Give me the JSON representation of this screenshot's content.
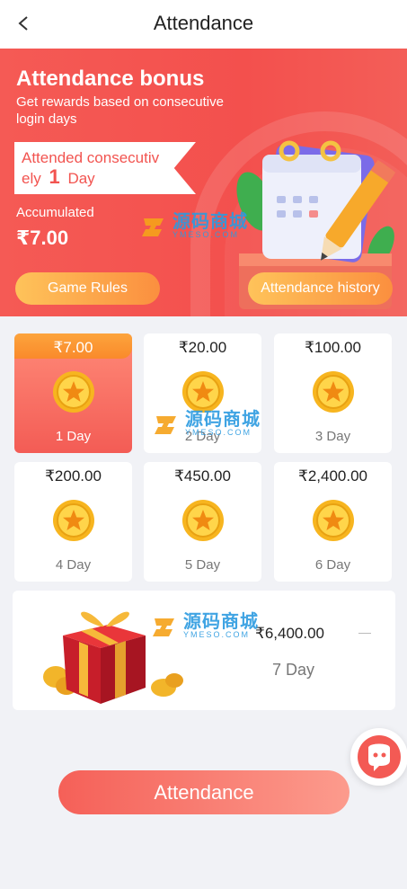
{
  "header": {
    "title": "Attendance"
  },
  "banner": {
    "title": "Attendance bonus",
    "subtitle": "Get rewards based on consecutive login days",
    "streak_prefix": "Attended consecutiv",
    "streak_prefix2": "ely",
    "streak_days": "1",
    "streak_unit": "Day",
    "accumulated_label": "Accumulated",
    "accumulated_value": "₹7.00",
    "rules_button": "Game Rules",
    "history_button": "Attendance history"
  },
  "watermark": {
    "cn": "源码商城",
    "en": "YMESO.COM"
  },
  "days": [
    {
      "amount": "₹7.00",
      "day": "1 Day",
      "active": true
    },
    {
      "amount": "₹20.00",
      "day": "2 Day",
      "active": false
    },
    {
      "amount": "₹100.00",
      "day": "3 Day",
      "active": false
    },
    {
      "amount": "₹200.00",
      "day": "4 Day",
      "active": false
    },
    {
      "amount": "₹450.00",
      "day": "5 Day",
      "active": false
    },
    {
      "amount": "₹2,400.00",
      "day": "6 Day",
      "active": false
    }
  ],
  "day7": {
    "amount": "₹6,400.00",
    "day": "7 Day"
  },
  "main_button": "Attendance"
}
